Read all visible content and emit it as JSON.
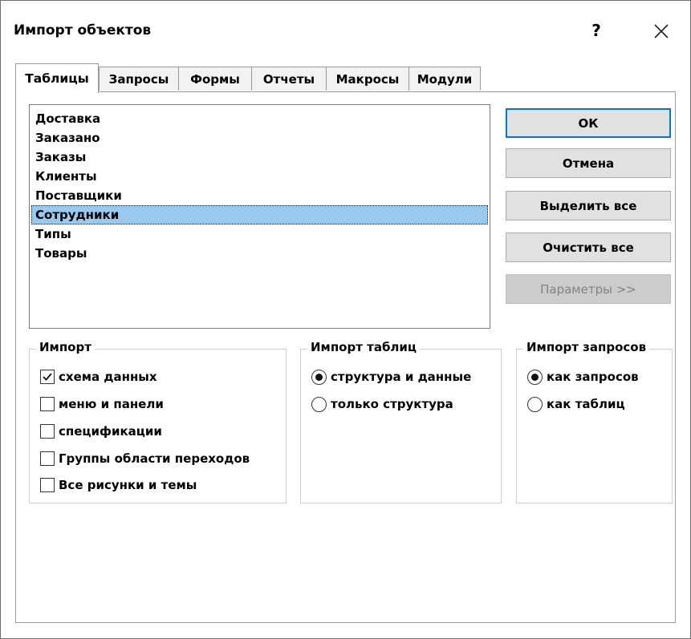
{
  "window": {
    "title": "Импорт объектов",
    "help_label": "?"
  },
  "tabs": [
    {
      "label": "Таблицы",
      "active": true
    },
    {
      "label": "Запросы",
      "active": false
    },
    {
      "label": "Формы",
      "active": false
    },
    {
      "label": "Отчеты",
      "active": false
    },
    {
      "label": "Макросы",
      "active": false
    },
    {
      "label": "Модули",
      "active": false
    }
  ],
  "object_list": {
    "items": [
      "Доставка",
      "Заказано",
      "Заказы",
      "Клиенты",
      "Поставщики",
      "Сотрудники",
      "Типы",
      "Товары"
    ],
    "selected": "Сотрудники"
  },
  "buttons": {
    "ok": "ОК",
    "cancel": "Отмена",
    "select_all": "Выделить все",
    "clear_all": "Очистить все",
    "options": "Параметры >>"
  },
  "import_group": {
    "label": "Импорт",
    "options": [
      {
        "label": "схема данных",
        "checked": true
      },
      {
        "label": "меню и панели",
        "checked": false
      },
      {
        "label": "спецификации",
        "checked": false
      },
      {
        "label": "Группы области переходов",
        "checked": false
      },
      {
        "label": "Все рисунки и темы",
        "checked": false
      }
    ]
  },
  "import_tables_group": {
    "label": "Импорт таблиц",
    "options": [
      {
        "label": "структура и данные",
        "selected": true
      },
      {
        "label": "только структура",
        "selected": false
      }
    ]
  },
  "import_queries_group": {
    "label": "Импорт запросов",
    "options": [
      {
        "label": "как запросов",
        "selected": true
      },
      {
        "label": "как таблиц",
        "selected": false
      }
    ]
  },
  "colors": {
    "selection": "#99c9ef",
    "default_button_border": "#0078d7"
  }
}
